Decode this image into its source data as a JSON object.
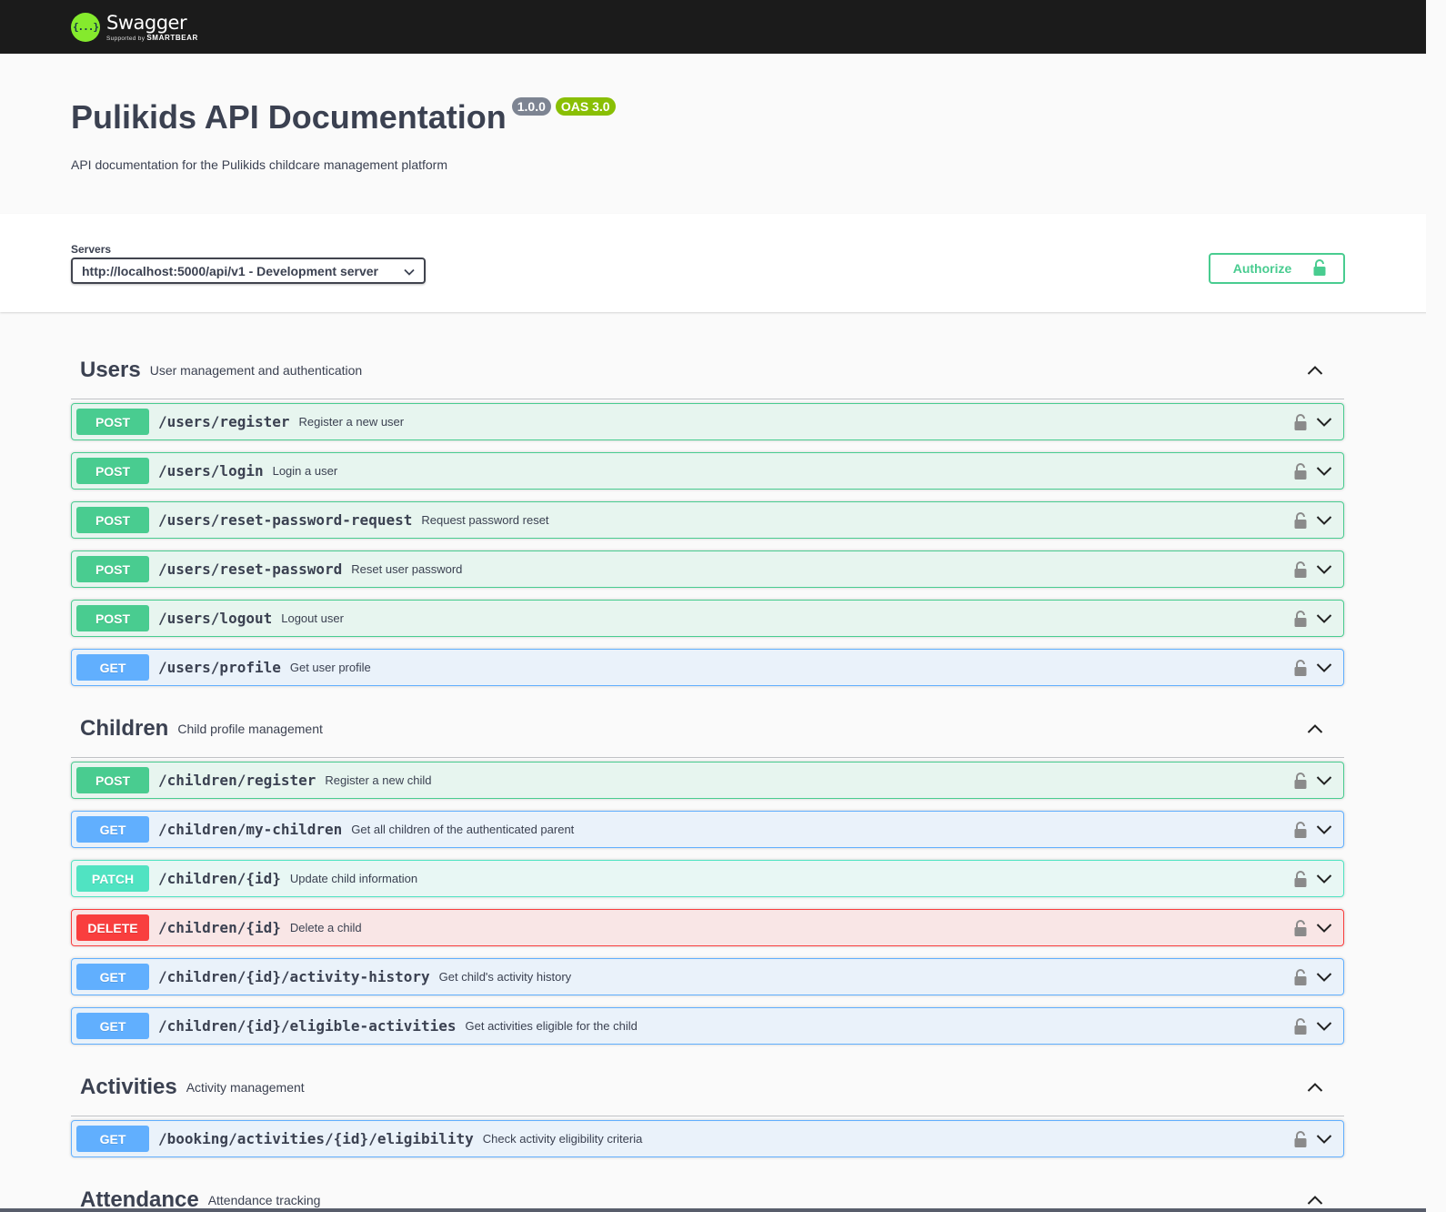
{
  "topbar": {
    "logo_name": "Swagger",
    "logo_sub_prefix": "Supported by ",
    "logo_sub_brand": "SMARTBEAR",
    "logo_mark": "{...}"
  },
  "info": {
    "title": "Pulikids API Documentation",
    "version_badge": "1.0.0",
    "oas_badge": "OAS 3.0",
    "description": "API documentation for the Pulikids childcare management platform"
  },
  "scheme": {
    "servers_label": "Servers",
    "selected_server": "http://localhost:5000/api/v1 - Development server",
    "authorize_label": "Authorize"
  },
  "colors": {
    "post": "#49cc90",
    "get": "#61affe",
    "patch": "#50e3c2",
    "delete": "#f93e3e",
    "topbar": "#1b1b1b"
  },
  "tags": [
    {
      "name": "Users",
      "description": "User management and authentication",
      "operations": [
        {
          "method": "POST",
          "path": "/users/register",
          "summary": "Register a new user"
        },
        {
          "method": "POST",
          "path": "/users/login",
          "summary": "Login a user"
        },
        {
          "method": "POST",
          "path": "/users/reset-password-request",
          "summary": "Request password reset"
        },
        {
          "method": "POST",
          "path": "/users/reset-password",
          "summary": "Reset user password"
        },
        {
          "method": "POST",
          "path": "/users/logout",
          "summary": "Logout user"
        },
        {
          "method": "GET",
          "path": "/users/profile",
          "summary": "Get user profile"
        }
      ]
    },
    {
      "name": "Children",
      "description": "Child profile management",
      "operations": [
        {
          "method": "POST",
          "path": "/children/register",
          "summary": "Register a new child"
        },
        {
          "method": "GET",
          "path": "/children/my-children",
          "summary": "Get all children of the authenticated parent"
        },
        {
          "method": "PATCH",
          "path": "/children/{id}",
          "summary": "Update child information"
        },
        {
          "method": "DELETE",
          "path": "/children/{id}",
          "summary": "Delete a child"
        },
        {
          "method": "GET",
          "path": "/children/{id}/activity-history",
          "summary": "Get child's activity history"
        },
        {
          "method": "GET",
          "path": "/children/{id}/eligible-activities",
          "summary": "Get activities eligible for the child"
        }
      ]
    },
    {
      "name": "Activities",
      "description": "Activity management",
      "operations": [
        {
          "method": "GET",
          "path": "/booking/activities/{id}/eligibility",
          "summary": "Check activity eligibility criteria"
        }
      ]
    },
    {
      "name": "Attendance",
      "description": "Attendance tracking",
      "operations": []
    }
  ]
}
